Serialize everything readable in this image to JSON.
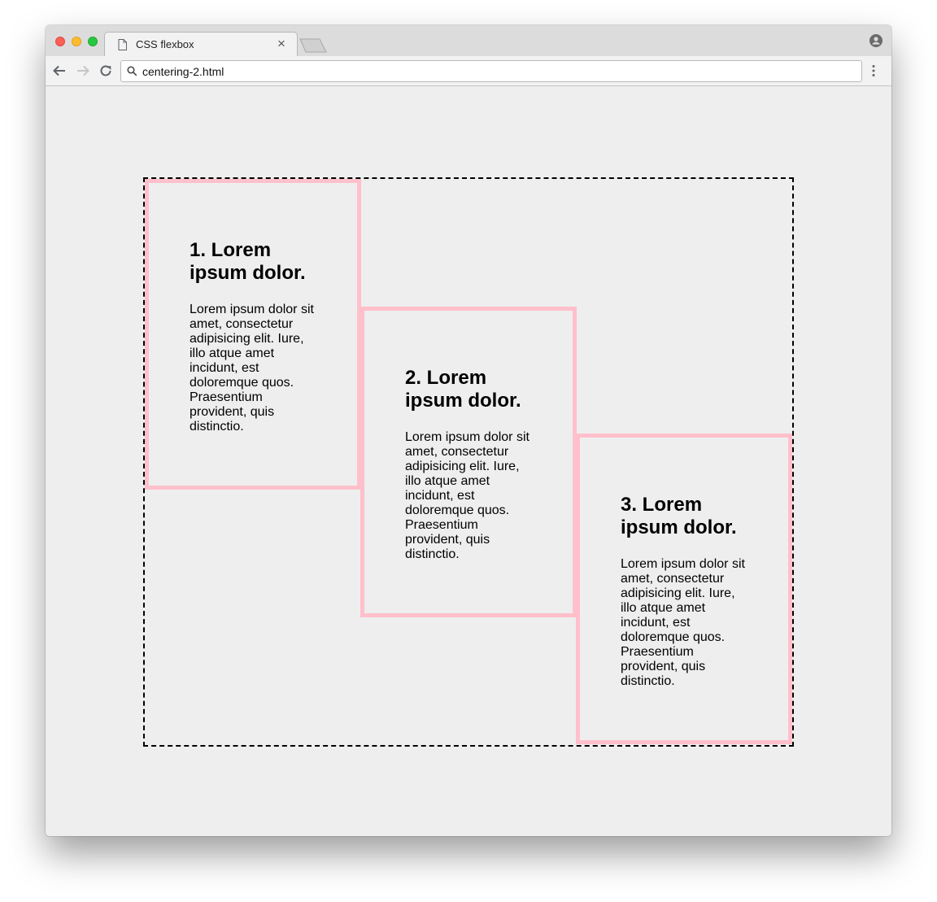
{
  "browser": {
    "tab_title": "CSS flexbox",
    "address": "centering-2.html",
    "icons": [
      "page-icon",
      "close-icon",
      "new-tab-icon",
      "profile-icon",
      "back-icon",
      "forward-icon",
      "reload-icon",
      "search-icon",
      "menu-icon"
    ]
  },
  "page": {
    "items": [
      {
        "heading": "1. Lorem ipsum dolor.",
        "body": "Lorem ipsum dolor sit amet, consectetur adipisicing elit. Iure, illo atque amet incidunt, est doloremque quos. Praesentium provident, quis distinctio."
      },
      {
        "heading": "2. Lorem ipsum dolor.",
        "body": "Lorem ipsum dolor sit amet, consectetur adipisicing elit. Iure, illo atque amet incidunt, est doloremque quos. Praesentium provident, quis distinctio."
      },
      {
        "heading": "3. Lorem ipsum dolor.",
        "body": "Lorem ipsum dolor sit amet, consectetur adipisicing elit. Iure, illo atque amet incidunt, est doloremque quos. Praesentium provident, quis distinctio."
      }
    ]
  },
  "colors": {
    "item_border": "#ffc0cb",
    "page_background": "#eeeeee",
    "container_border": "#000000"
  }
}
